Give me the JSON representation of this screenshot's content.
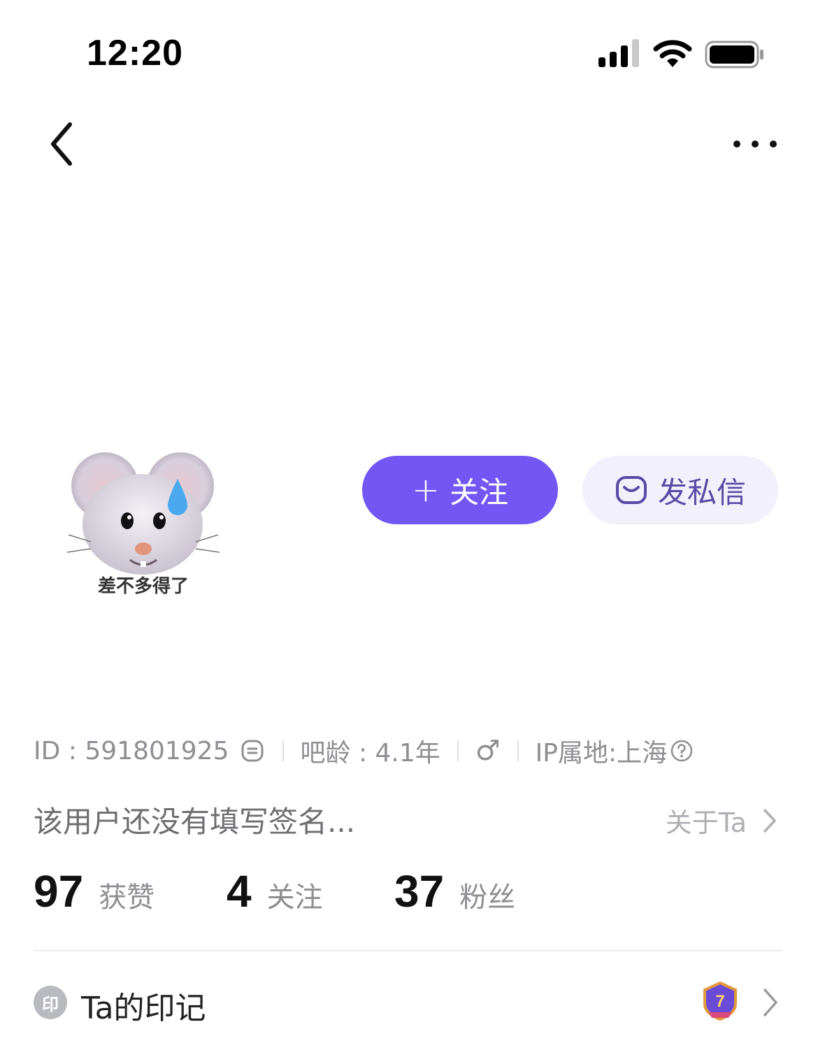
{
  "status_bar": {
    "time": "12:20"
  },
  "avatar": {
    "caption": "差不多得了"
  },
  "actions": {
    "follow_label": "关注",
    "message_label": "发私信"
  },
  "info": {
    "id": "ID : 591801925",
    "age": "吧龄 : 4.1年",
    "gender_symbol": "♂",
    "ip": "IP属地:上海"
  },
  "signature": "该用户还没有填写签名...",
  "about_label": "关于Ta",
  "stats": [
    {
      "value": "97",
      "label": "获赞"
    },
    {
      "value": "4",
      "label": "关注"
    },
    {
      "value": "37",
      "label": "粉丝"
    }
  ],
  "imprint": {
    "icon_text": "印",
    "label": "Ta的印记",
    "badge_level": "7"
  },
  "colors": {
    "accent": "#7257f5",
    "message_bg": "#f2f0fb"
  }
}
